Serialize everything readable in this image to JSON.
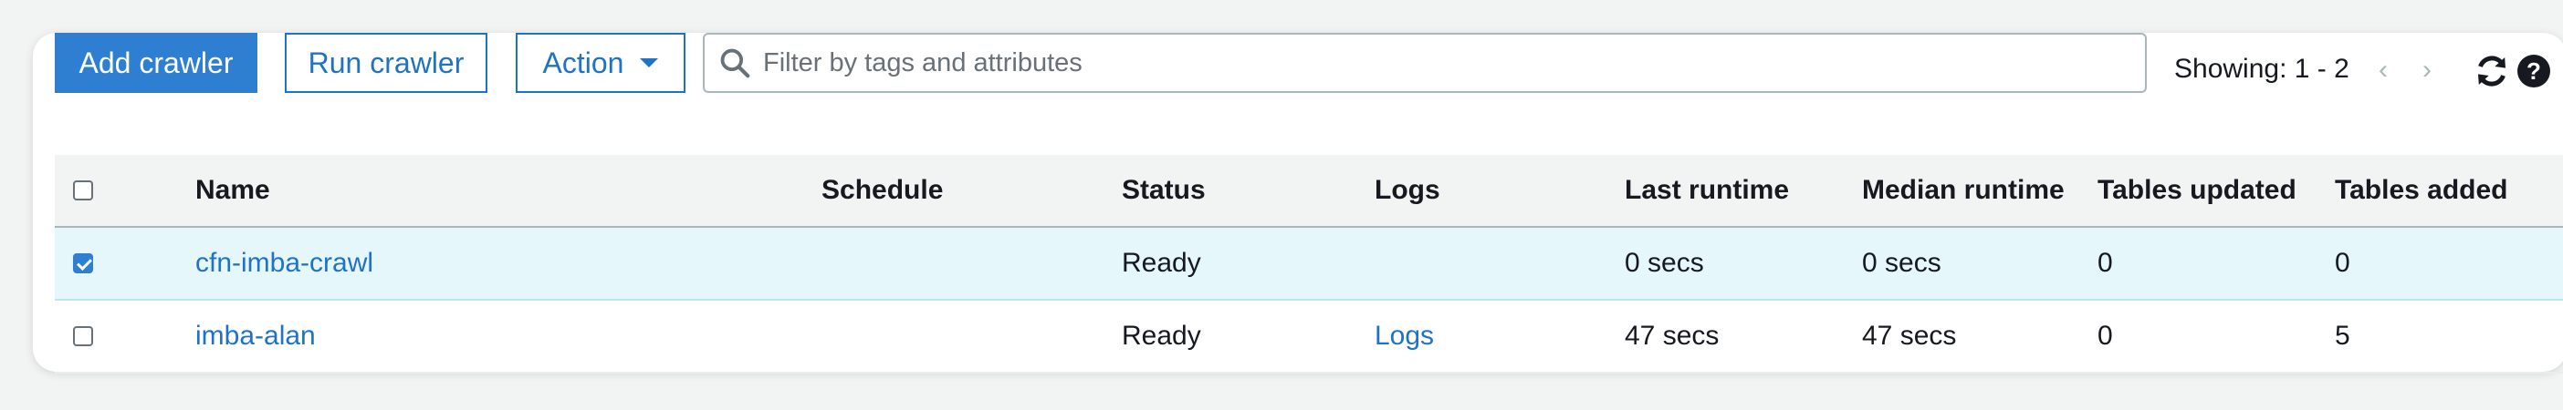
{
  "toolbar": {
    "add_label": "Add crawler",
    "run_label": "Run crawler",
    "action_label": "Action",
    "search_placeholder": "Filter by tags and attributes",
    "showing": "Showing: 1 - 2"
  },
  "colors": {
    "primary": "#2e7fd1",
    "link": "#1f73c4",
    "selected_row": "#e6f7fb",
    "header_bg": "#f2f3f3"
  },
  "table": {
    "headers": [
      "Name",
      "Schedule",
      "Status",
      "Logs",
      "Last runtime",
      "Median runtime",
      "Tables updated",
      "Tables added"
    ],
    "rows": [
      {
        "selected": true,
        "name": "cfn-imba-crawl",
        "schedule": "",
        "status": "Ready",
        "logs": "",
        "last_runtime": "0 secs",
        "median_runtime": "0 secs",
        "tables_updated": "0",
        "tables_added": "0"
      },
      {
        "selected": false,
        "name": "imba-alan",
        "schedule": "",
        "status": "Ready",
        "logs": "Logs",
        "last_runtime": "47 secs",
        "median_runtime": "47 secs",
        "tables_updated": "0",
        "tables_added": "5"
      }
    ]
  }
}
